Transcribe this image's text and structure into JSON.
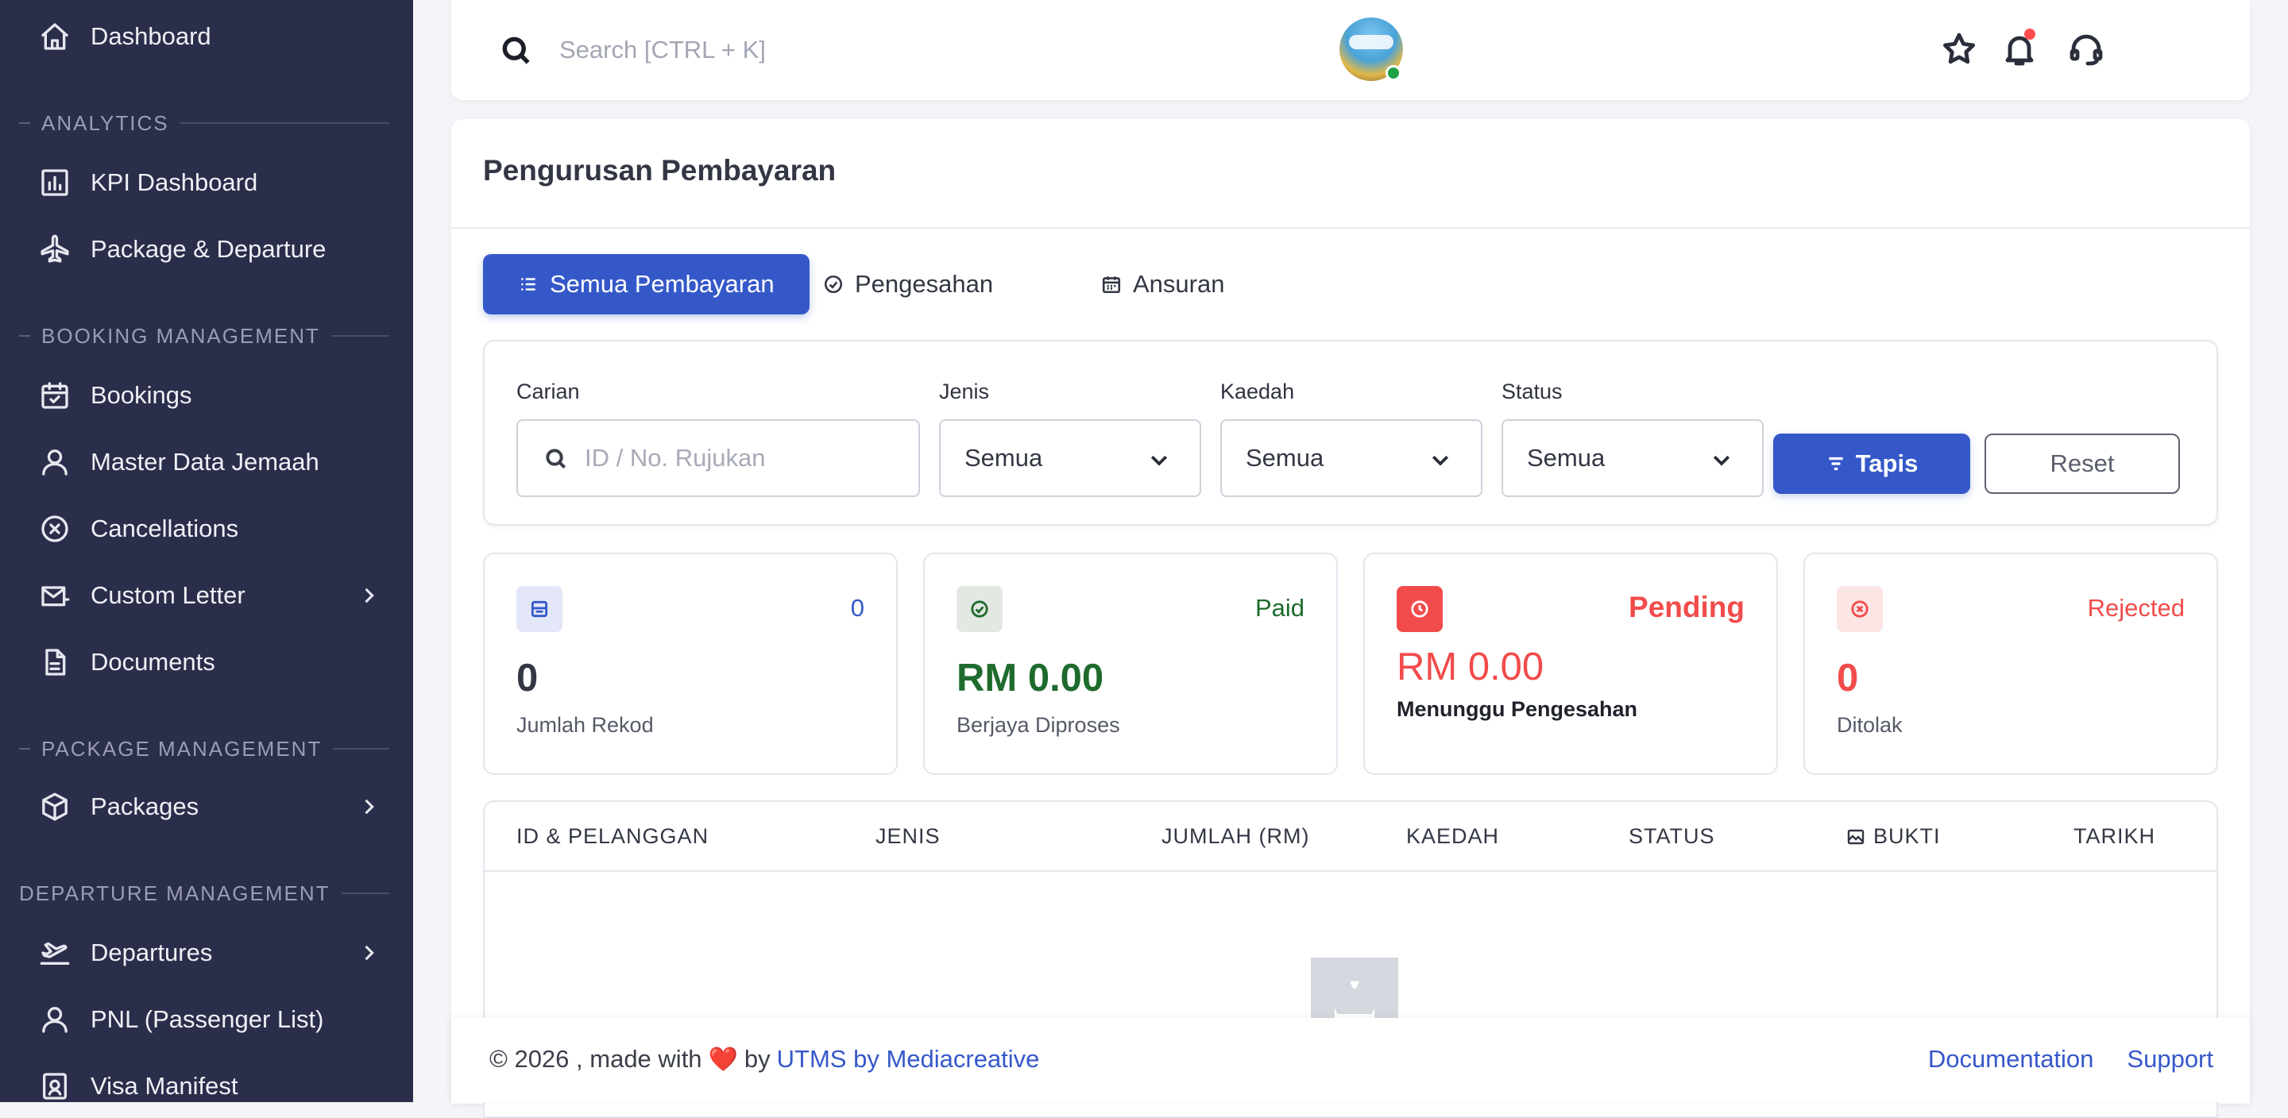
{
  "sidebar": {
    "items": {
      "dashboard": "Dashboard",
      "kpi_dashboard": "KPI Dashboard",
      "package_departure": "Package & Departure",
      "bookings": "Bookings",
      "master_data_jemaah": "Master Data Jemaah",
      "cancellations": "Cancellations",
      "custom_letter": "Custom Letter",
      "documents": "Documents",
      "packages": "Packages",
      "departures": "Departures",
      "pnl": "PNL (Passenger List)",
      "visa_manifest": "Visa Manifest"
    },
    "sections": {
      "analytics": "ANALYTICS",
      "booking_management": "BOOKING MANAGEMENT",
      "package_management": "PACKAGE MANAGEMENT",
      "departure_management": "DEPARTURE MANAGEMENT"
    }
  },
  "topbar": {
    "search_placeholder": "Search [CTRL + K]",
    "icons": [
      "star-icon",
      "bell-icon",
      "headset-icon"
    ],
    "notification_dot_color": "#ff4d4f",
    "avatar_status_color": "#1fa346"
  },
  "page": {
    "title": "Pengurusan Pembayaran",
    "tabs": {
      "all": "Semua Pembayaran",
      "verification": "Pengesahan",
      "installment": "Ansuran"
    }
  },
  "filters": {
    "search_label": "Carian",
    "search_placeholder": "ID / No. Rujukan",
    "type_label": "Jenis",
    "type_value": "Semua",
    "method_label": "Kaedah",
    "method_value": "Semua",
    "status_label": "Status",
    "status_value": "Semua",
    "filter_button": "Tapis",
    "reset_button": "Reset"
  },
  "stats": {
    "total": {
      "badge": "0",
      "value": "0",
      "label": "Jumlah Rekod"
    },
    "paid": {
      "badge": "Paid",
      "value": "RM 0.00",
      "label": "Berjaya Diproses"
    },
    "pending": {
      "badge": "Pending",
      "value": "RM 0.00",
      "label": "Menunggu Pengesahan"
    },
    "rejected": {
      "badge": "Rejected",
      "value": "0",
      "label": "Ditolak"
    }
  },
  "table": {
    "columns": {
      "id_customer": "ID & PELANGGAN",
      "type": "JENIS",
      "amount": "JUMLAH (RM)",
      "method": "KAEDAH",
      "status": "STATUS",
      "proof": "BUKTI",
      "date": "TARIKH"
    },
    "rows": []
  },
  "footer": {
    "copyright": "© 2026 , made with",
    "by": "by",
    "brand_link": "UTMS by Mediacreative",
    "documentation": "Documentation",
    "support": "Support"
  },
  "colors": {
    "sidebar_bg": "#2b2e4a",
    "primary": "#3558c9",
    "success": "#1e6b2d",
    "danger": "#f24b4b"
  }
}
